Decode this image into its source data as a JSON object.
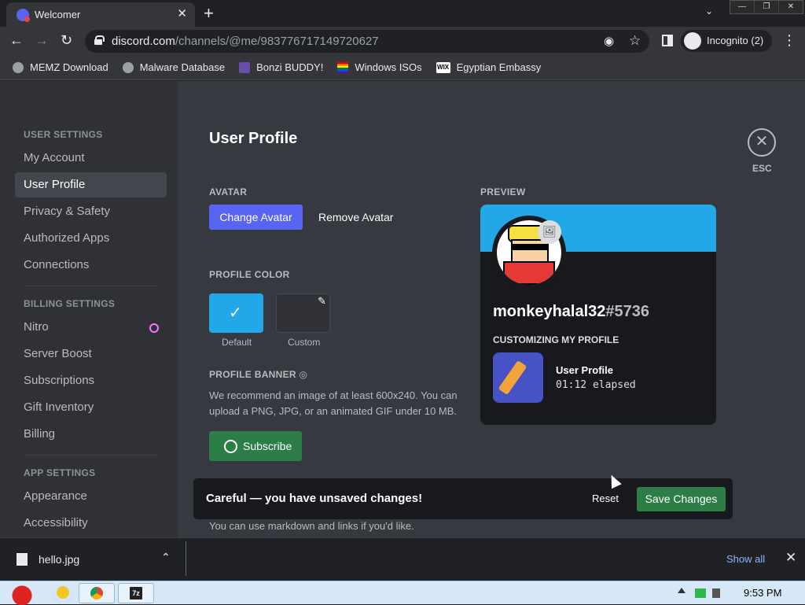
{
  "browser": {
    "tab_title": "Welcomer",
    "tab_close": "✕",
    "new_tab": "+",
    "url_domain": "discord.com",
    "url_path": "/channels/@me/983776717149720627",
    "incognito_label": "Incognito (2)",
    "bookmarks": [
      {
        "label": "MEMZ Download",
        "icon": "globe-icon"
      },
      {
        "label": "Malware Database",
        "icon": "globe-icon"
      },
      {
        "label": "Bonzi BUDDY!",
        "icon": "bonzi-icon"
      },
      {
        "label": "Windows ISOs",
        "icon": "rainbow-flag-icon"
      },
      {
        "label": "Egyptian Embassy",
        "icon": "wix-icon"
      }
    ]
  },
  "sidebar": {
    "user_settings_header": "USER SETTINGS",
    "user_items": [
      "My Account",
      "User Profile",
      "Privacy & Safety",
      "Authorized Apps",
      "Connections"
    ],
    "billing_header": "BILLING SETTINGS",
    "billing_items": [
      "Nitro",
      "Server Boost",
      "Subscriptions",
      "Gift Inventory",
      "Billing"
    ],
    "app_header": "APP SETTINGS",
    "app_items": [
      "Appearance",
      "Accessibility"
    ]
  },
  "main": {
    "title": "User Profile",
    "esc_label": "ESC",
    "avatar_header": "AVATAR",
    "change_avatar": "Change Avatar",
    "remove_avatar": "Remove Avatar",
    "profile_color_header": "PROFILE COLOR",
    "color_default_label": "Default",
    "color_custom_label": "Custom",
    "profile_banner_header": "PROFILE BANNER",
    "banner_description": "We recommend an image of at least 600x240. You can upload a PNG, JPG, or an animated GIF under 10 MB.",
    "subscribe_label": "Subscribe",
    "markdown_hint": "You can use markdown and links if you'd like.",
    "preview_header": "PREVIEW"
  },
  "preview": {
    "username": "monkeyhalal32",
    "discriminator": "#5736",
    "customizing_header": "CUSTOMIZING MY PROFILE",
    "activity_title": "User Profile",
    "activity_elapsed": "01:12 elapsed"
  },
  "unsaved_bar": {
    "message": "Careful — you have unsaved changes!",
    "reset": "Reset",
    "save": "Save Changes"
  },
  "download_shelf": {
    "file_name": "hello.jpg",
    "show_all": "Show all"
  },
  "taskbar": {
    "clock": "9:53 PM"
  },
  "colors": {
    "accent": "#5865f2",
    "profile_default": "#22a8e8",
    "green": "#2d7d46"
  }
}
